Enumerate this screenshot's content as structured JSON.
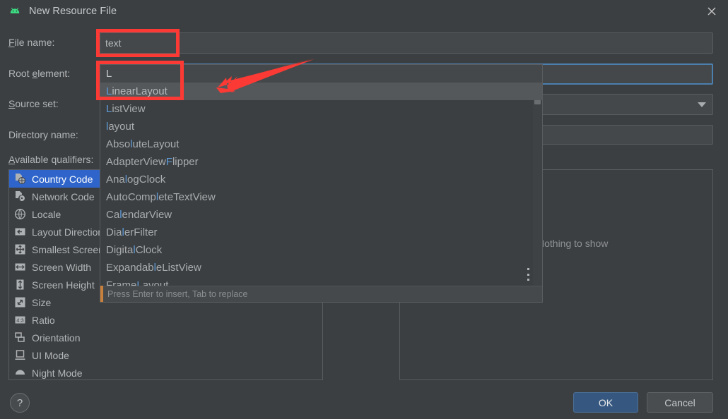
{
  "window": {
    "title": "New Resource File",
    "app_icon": "android-icon",
    "close_icon": "close-icon"
  },
  "form": {
    "file_name": {
      "label_pre": "F",
      "label_post": "ile name:",
      "value": "text"
    },
    "root_element": {
      "label_pre": "Root ",
      "label_mnemonic": "e",
      "label_post": "lement:",
      "value": "L"
    },
    "source_set": {
      "label_pre": "S",
      "label_post": "ource set:",
      "value": "",
      "dropdown_icon": "chevron-down-icon"
    },
    "directory_name": {
      "label": "Directory name:",
      "value": ""
    },
    "available_qualifiers": {
      "label_pre": "A",
      "label_post": "vailable qualifiers:"
    }
  },
  "qualifiers": [
    {
      "label": "Country Code",
      "icon": "country-code-icon",
      "selected": true
    },
    {
      "label": "Network Code",
      "icon": "network-code-icon",
      "selected": false
    },
    {
      "label": "Locale",
      "icon": "locale-globe-icon",
      "selected": false
    },
    {
      "label": "Layout Direction",
      "icon": "layout-direction-icon",
      "selected": false
    },
    {
      "label": "Smallest Screen Width",
      "icon": "smallest-screen-width-icon",
      "selected": false
    },
    {
      "label": "Screen Width",
      "icon": "screen-width-icon",
      "selected": false
    },
    {
      "label": "Screen Height",
      "icon": "screen-height-icon",
      "selected": false
    },
    {
      "label": "Size",
      "icon": "size-icon",
      "selected": false
    },
    {
      "label": "Ratio",
      "icon": "ratio-icon",
      "selected": false
    },
    {
      "label": "Orientation",
      "icon": "orientation-icon",
      "selected": false
    },
    {
      "label": "UI Mode",
      "icon": "ui-mode-icon",
      "selected": false
    },
    {
      "label": "Night Mode",
      "icon": "night-mode-icon",
      "selected": false
    }
  ],
  "chosen_panel": {
    "empty_text": "Nothing to show"
  },
  "autocomplete": {
    "typed_row": "L",
    "hint": "Press Enter to insert, Tab to replace",
    "more_icon": "more-options-icon",
    "items": [
      {
        "pre": "",
        "match": "L",
        "post": "inearLayout",
        "selected": true
      },
      {
        "pre": "",
        "match": "L",
        "post": "istView",
        "selected": false
      },
      {
        "pre": "",
        "match": "l",
        "post": "ayout",
        "selected": false
      },
      {
        "pre": "Abso",
        "match": "l",
        "post": "uteLayout",
        "selected": false
      },
      {
        "pre": "AdapterView",
        "match": "F",
        "post": "lipper",
        "selected": false
      },
      {
        "pre": "Ana",
        "match": "l",
        "post": "ogClock",
        "selected": false
      },
      {
        "pre": "AutoComp",
        "match": "l",
        "post": "eteTextView",
        "selected": false
      },
      {
        "pre": "Ca",
        "match": "l",
        "post": "endarView",
        "selected": false
      },
      {
        "pre": "Dia",
        "match": "l",
        "post": "erFilter",
        "selected": false
      },
      {
        "pre": "Digita",
        "match": "l",
        "post": "Clock",
        "selected": false
      },
      {
        "pre": "Expandab",
        "match": "l",
        "post": "eListView",
        "selected": false
      },
      {
        "pre": "Frame",
        "match": "L",
        "post": "ayout",
        "selected": false
      }
    ]
  },
  "footer": {
    "help_label": "?",
    "ok_label": "OK",
    "cancel_label": "Cancel"
  },
  "colors": {
    "dialog_bg": "#3c3f41",
    "field_bg": "#45484a",
    "selection_blue": "#2f65ca",
    "focus_border": "#4b7fae",
    "match_blue": "#5e9bd8",
    "annotation_red": "#fb3a35",
    "primary_button": "#365880",
    "android_green": "#3ddc84"
  }
}
